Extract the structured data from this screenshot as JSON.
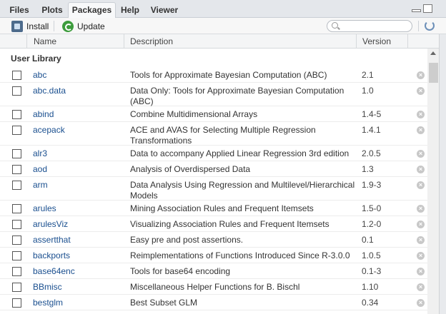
{
  "tabs": [
    "Files",
    "Plots",
    "Packages",
    "Help",
    "Viewer"
  ],
  "toolbar": {
    "install_label": "Install",
    "update_label": "Update",
    "search_placeholder": ""
  },
  "columns": {
    "name": "Name",
    "description": "Description",
    "version": "Version"
  },
  "section_title": "User Library",
  "packages": [
    {
      "name": "abc",
      "desc1": "Tools for Approximate Bayesian Computation (ABC)",
      "desc2": "",
      "version": "2.1"
    },
    {
      "name": "abc.data",
      "desc1": "Data Only: Tools for Approximate Bayesian Computation",
      "desc2": "(ABC)",
      "version": "1.0"
    },
    {
      "name": "abind",
      "desc1": "Combine Multidimensional Arrays",
      "desc2": "",
      "version": "1.4-5"
    },
    {
      "name": "acepack",
      "desc1": "ACE and AVAS for Selecting Multiple Regression",
      "desc2": "Transformations",
      "version": "1.4.1"
    },
    {
      "name": "alr3",
      "desc1": "Data to accompany Applied Linear Regression 3rd edition",
      "desc2": "",
      "version": "2.0.5"
    },
    {
      "name": "aod",
      "desc1": "Analysis of Overdispersed Data",
      "desc2": "",
      "version": "1.3"
    },
    {
      "name": "arm",
      "desc1": "Data Analysis Using Regression and Multilevel/Hierarchical",
      "desc2": "Models",
      "version": "1.9-3"
    },
    {
      "name": "arules",
      "desc1": "Mining Association Rules and Frequent Itemsets",
      "desc2": "",
      "version": "1.5-0"
    },
    {
      "name": "arulesViz",
      "desc1": "Visualizing Association Rules and Frequent Itemsets",
      "desc2": "",
      "version": "1.2-0"
    },
    {
      "name": "assertthat",
      "desc1": "Easy pre and post assertions.",
      "desc2": "",
      "version": "0.1"
    },
    {
      "name": "backports",
      "desc1": "Reimplementations of Functions Introduced Since R-3.0.0",
      "desc2": "",
      "version": "1.0.5"
    },
    {
      "name": "base64enc",
      "desc1": "Tools for base64 encoding",
      "desc2": "",
      "version": "0.1-3"
    },
    {
      "name": "BBmisc",
      "desc1": "Miscellaneous Helper Functions for B. Bischl",
      "desc2": "",
      "version": "1.10"
    },
    {
      "name": "bestglm",
      "desc1": "Best Subset GLM",
      "desc2": "",
      "version": "0.34"
    }
  ]
}
